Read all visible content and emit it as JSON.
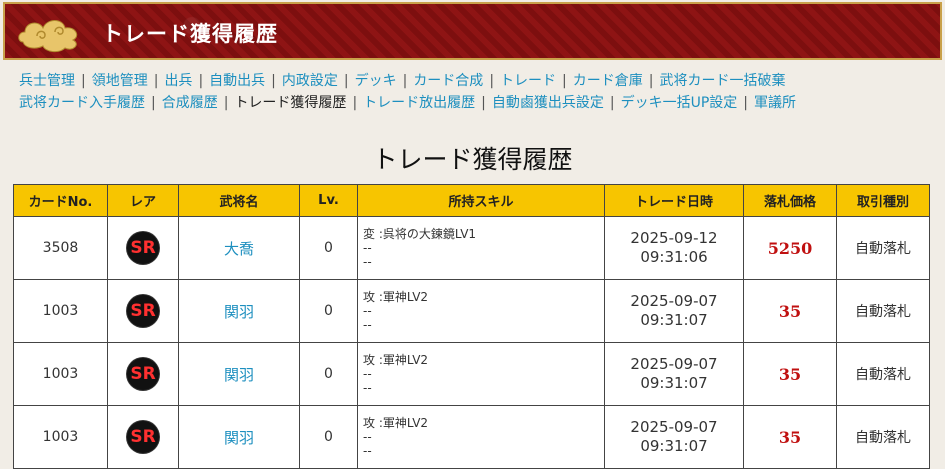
{
  "header": {
    "title": "トレード獲得履歴"
  },
  "nav": {
    "row1": [
      "兵士管理",
      "領地管理",
      "出兵",
      "自動出兵",
      "内政設定",
      "デッキ",
      "カード合成",
      "トレード",
      "カード倉庫",
      "武将カード一括破棄"
    ],
    "row2": [
      "武将カード入手履歴",
      "合成履歴",
      "トレード獲得履歴",
      "トレード放出履歴",
      "自動鹵獲出兵設定",
      "デッキ一括UP設定",
      "軍議所"
    ]
  },
  "page_title": "トレード獲得履歴",
  "table": {
    "headers": [
      "カードNo.",
      "レア",
      "武将名",
      "Lv.",
      "所持スキル",
      "トレード日時",
      "落札価格",
      "取引種別"
    ],
    "rows": [
      {
        "card_no": "3508",
        "rarity": "SR",
        "name": "大喬",
        "lv": "0",
        "skill1": "変 :呉将の大鍊鏡LV1",
        "skill2": "--",
        "skill3": "--",
        "date": "2025-09-12",
        "time": "09:31:06",
        "price": "5250",
        "type": "自動落札"
      },
      {
        "card_no": "1003",
        "rarity": "SR",
        "name": "関羽",
        "lv": "0",
        "skill1": "攻 :軍神LV2",
        "skill2": "--",
        "skill3": "--",
        "date": "2025-09-07",
        "time": "09:31:07",
        "price": "35",
        "type": "自動落札"
      },
      {
        "card_no": "1003",
        "rarity": "SR",
        "name": "関羽",
        "lv": "0",
        "skill1": "攻 :軍神LV2",
        "skill2": "--",
        "skill3": "--",
        "date": "2025-09-07",
        "time": "09:31:07",
        "price": "35",
        "type": "自動落札"
      },
      {
        "card_no": "1003",
        "rarity": "SR",
        "name": "関羽",
        "lv": "0",
        "skill1": "攻 :軍神LV2",
        "skill2": "--",
        "skill3": "--",
        "date": "2025-09-07",
        "time": "09:31:07",
        "price": "35",
        "type": "自動落札"
      }
    ]
  },
  "colors": {
    "header_bg": "#8e1414",
    "table_header": "#f7c500",
    "link": "#1d8fbf",
    "price": "#c01010"
  }
}
